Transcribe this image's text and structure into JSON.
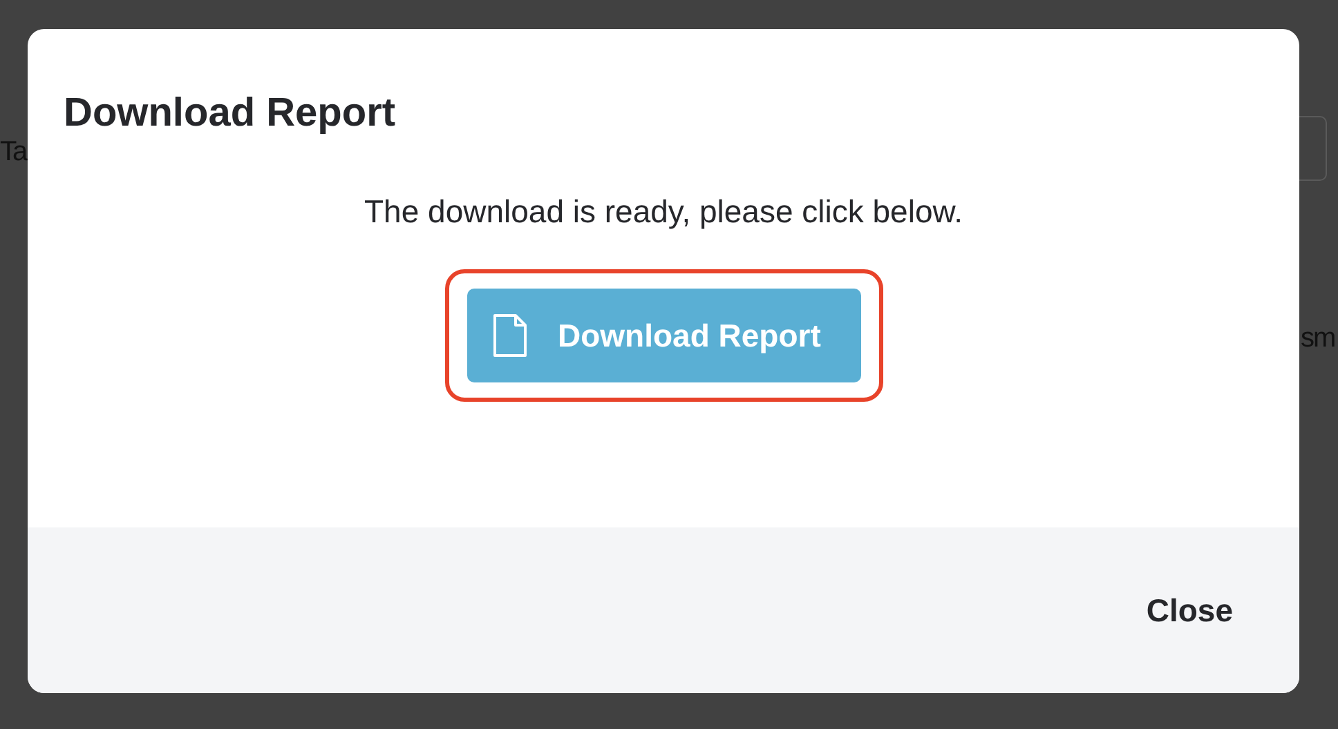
{
  "background": {
    "fragments": [
      {
        "text": "Ta"
      },
      {
        "text": "sm"
      }
    ]
  },
  "dialog": {
    "title": "Download Report",
    "message": "The download is ready, please click below.",
    "action": {
      "label": "Download Report",
      "highlighted": true
    },
    "footer_buttons": [
      "Close"
    ]
  }
}
